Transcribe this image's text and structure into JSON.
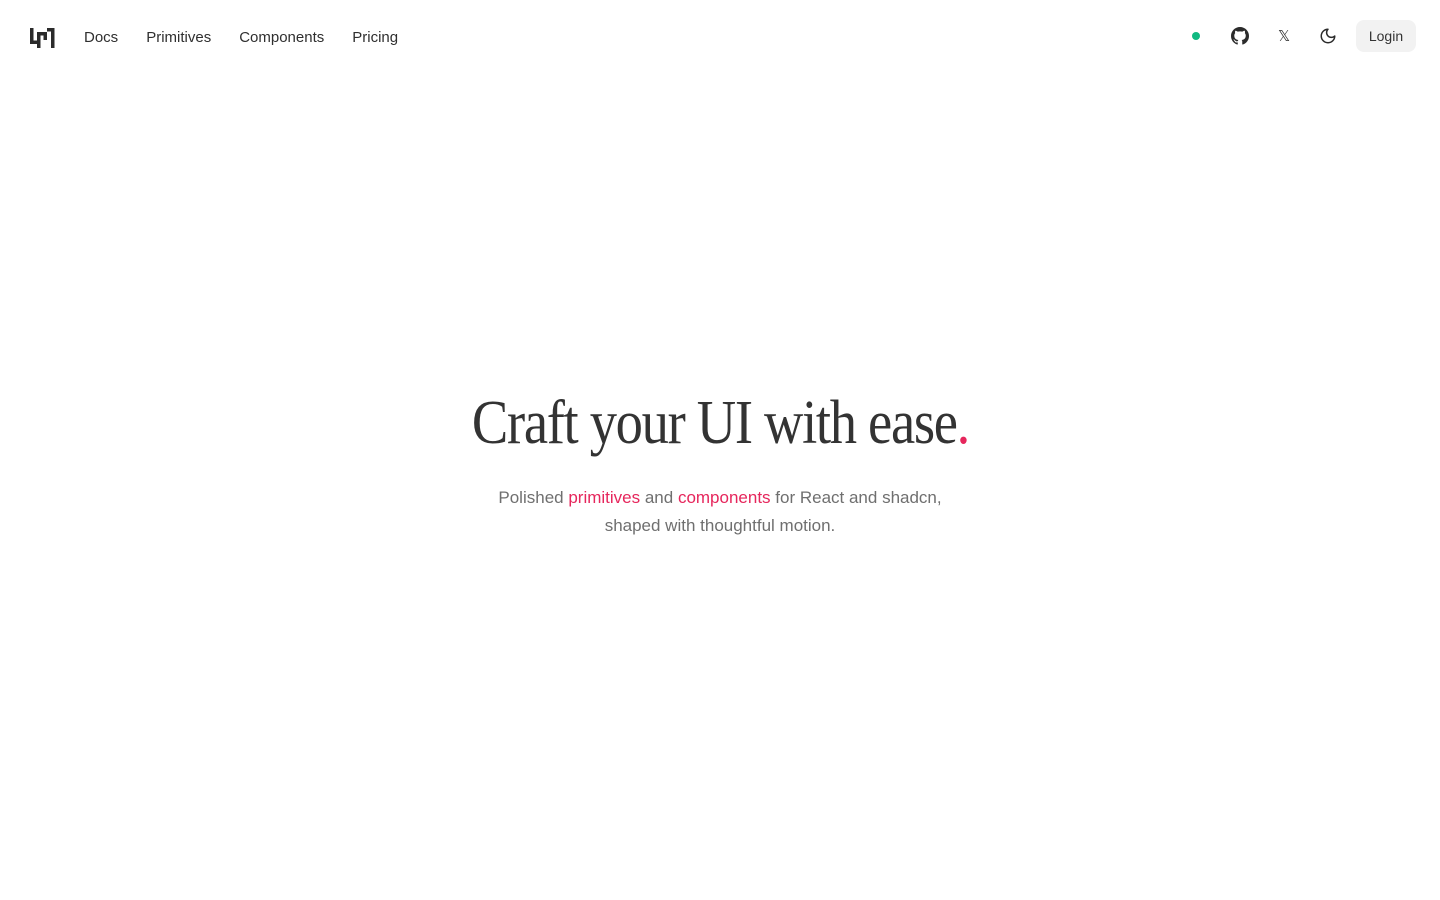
{
  "header": {
    "logo_icon": "brand-logo-icon",
    "nav": [
      {
        "label": "Docs"
      },
      {
        "label": "Primitives"
      },
      {
        "label": "Components"
      },
      {
        "label": "Pricing"
      }
    ],
    "status_color": "#10b981",
    "github_icon": "github-icon",
    "x_icon": "x-logo-icon",
    "x_glyph": "𝕏",
    "theme_icon": "moon-icon",
    "login_label": "Login"
  },
  "hero": {
    "title_text": "Craft your UI with ease",
    "title_dot": ".",
    "sub_line1_start": "Polished ",
    "sub_link1": "primitives",
    "sub_mid": " and ",
    "sub_link2": "components",
    "sub_line1_end": " for React and shadcn,",
    "sub_line2": "shaped with thoughtful motion."
  },
  "colors": {
    "accent": "#e6265c",
    "text": "#333333",
    "muted": "#6f6f6f",
    "button_bg": "#f2f2f2"
  }
}
